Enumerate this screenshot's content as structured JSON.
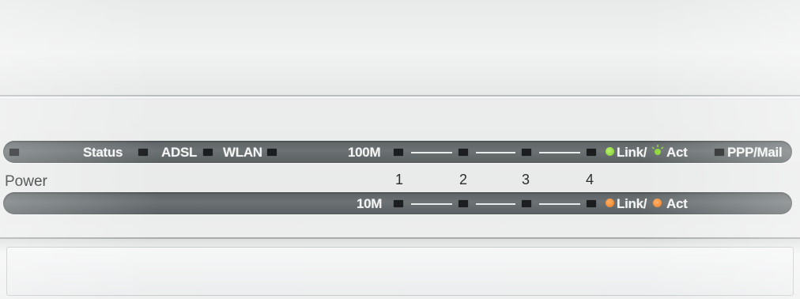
{
  "panel": {
    "top_labels": {
      "status": "Status",
      "adsl": "ADSL",
      "wlan": "WLAN",
      "speed_100": "100M",
      "link": "Link/",
      "act": "Act",
      "ppp_mail": "PPP/Mail"
    },
    "power_label": "Power",
    "port_numbers": [
      "1",
      "2",
      "3",
      "4"
    ],
    "bottom_labels": {
      "speed_10": "10M",
      "link": "Link/",
      "act": "Act"
    }
  },
  "colors": {
    "strip": "#656b6d",
    "led_off": "#1b1d1e",
    "link_100_green": "#8fd63a",
    "link_10_orange": "#f07a1c"
  }
}
